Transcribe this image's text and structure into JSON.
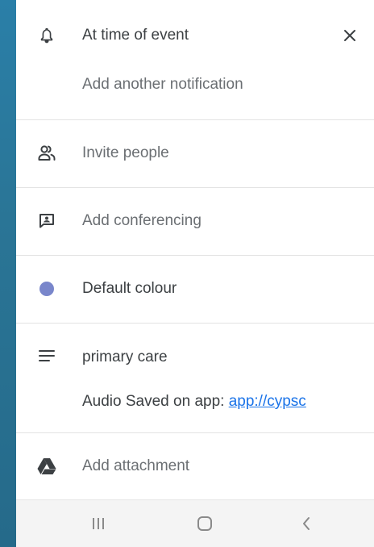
{
  "notification": {
    "current": "At time of event",
    "add_another": "Add another notification"
  },
  "guests": {
    "label": "Invite people"
  },
  "conferencing": {
    "label": "Add conferencing"
  },
  "colour": {
    "label": "Default colour",
    "swatch": "#7986cb"
  },
  "description": {
    "line1": "primary care",
    "line2_prefix": "Audio Saved on app: ",
    "link": "app://cypsc"
  },
  "attachment": {
    "label": "Add attachment"
  },
  "icons": {
    "notification": "bell-icon",
    "close": "close-icon",
    "guests": "people-icon",
    "conferencing": "conferencing-icon",
    "colour": "color-dot-icon",
    "description": "notes-lines-icon",
    "attachment": "google-drive-icon",
    "nav_recents": "recents-icon",
    "nav_home": "home-icon",
    "nav_back": "back-icon"
  },
  "colors": {
    "link": "#1a73e8",
    "text": "#3c4043",
    "muted_text": "#6b6f73",
    "background_gradient": "#2a7fa8"
  }
}
